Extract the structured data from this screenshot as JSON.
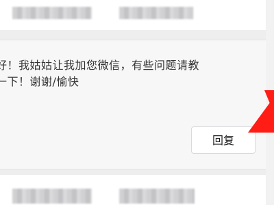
{
  "message": {
    "line1": "好！我姑姑让我加您微信，有些问题请教",
    "line2": "一下！谢谢/愉快"
  },
  "actions": {
    "reply_label": "回复"
  },
  "colors": {
    "arrow": "#ff1d16",
    "card_background": "#f7f7f8",
    "button_border": "#d9d9dc"
  }
}
